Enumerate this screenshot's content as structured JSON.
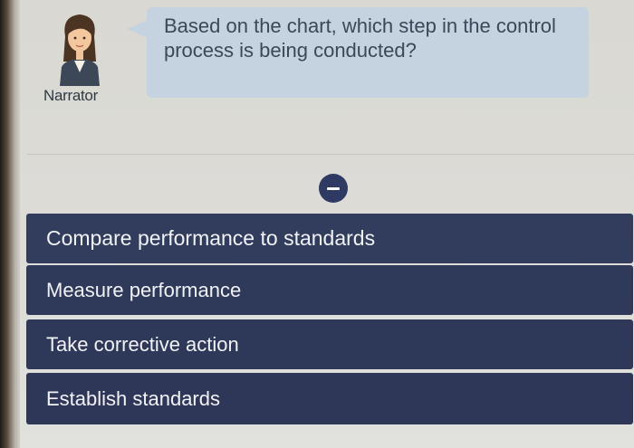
{
  "narrator": {
    "label": "Narrator"
  },
  "question": {
    "text": "Based on the chart, which step in the control process is being conducted?"
  },
  "options": [
    {
      "label": "Compare performance to standards"
    },
    {
      "label": "Measure performance"
    },
    {
      "label": "Take corrective action"
    },
    {
      "label": "Establish standards"
    }
  ],
  "colors": {
    "bubble": "#c5d2e0",
    "option_bg": "#2f3a5b",
    "option_text": "#f1f2f6",
    "collapse_button": "#2e3a63"
  },
  "icons": {
    "collapse": "minus-circle-icon",
    "narrator": "narrator-avatar-icon"
  }
}
